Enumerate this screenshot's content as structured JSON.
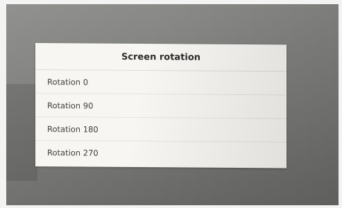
{
  "dialog": {
    "title": "Screen rotation",
    "options": [
      {
        "label": "Rotation 0"
      },
      {
        "label": "Rotation 90"
      },
      {
        "label": "Rotation 180"
      },
      {
        "label": "Rotation 270"
      }
    ]
  },
  "colors": {
    "screen_background": "#7f807d",
    "dialog_background": "#f7f6f3",
    "title_text": "#2c2c2c",
    "option_text": "#3a3a3a",
    "divider": "#e3e3df"
  }
}
